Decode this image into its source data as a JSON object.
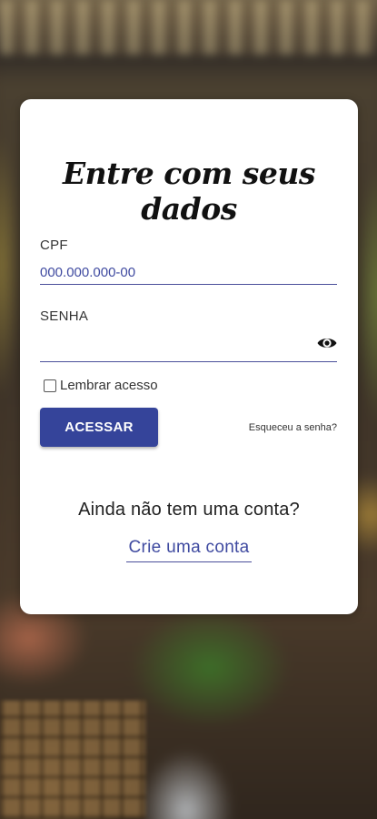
{
  "login": {
    "title": "Entre com seus dados",
    "cpf_label": "CPF",
    "cpf_placeholder": "000.000.000-00",
    "cpf_value": "",
    "password_label": "SENHA",
    "password_value": "",
    "remember_label": "Lembrar acesso",
    "remember_checked": false,
    "submit_label": "ACESSAR",
    "forgot_label": "Esqueceu a senha?",
    "no_account_text": "Ainda não tem uma conta?",
    "create_account_label": "Crie uma conta"
  },
  "icons": {
    "show_password": "eye-icon"
  },
  "colors": {
    "accent": "#35449a",
    "link": "#3f4aa0",
    "card": "#ffffff"
  }
}
